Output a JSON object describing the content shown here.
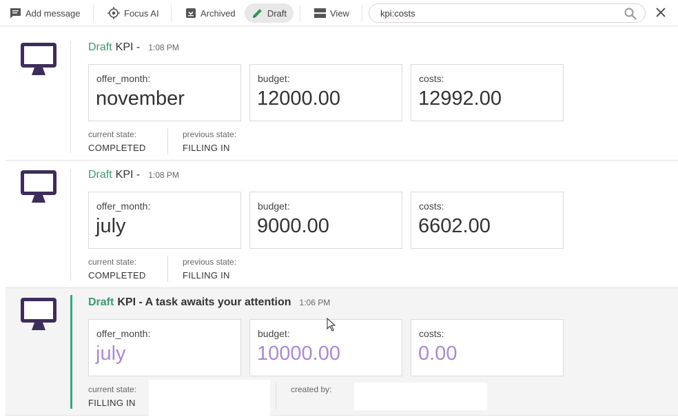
{
  "toolbar": {
    "add_message": "Add message",
    "focus_ai": "Focus AI",
    "archived": "Archived",
    "draft": "Draft",
    "view": "View"
  },
  "search": {
    "value": "kpi:costs"
  },
  "messages": [
    {
      "status": "Draft",
      "title": "KPI -",
      "time": "1:08 PM",
      "fields": [
        {
          "label": "offer_month:",
          "value": "november"
        },
        {
          "label": "budget:",
          "value": "12000.00"
        },
        {
          "label": "costs:",
          "value": "12992.00"
        }
      ],
      "current_state_label": "current state:",
      "current_state": "COMPLETED",
      "previous_state_label": "previous state:",
      "previous_state": "FILLING IN"
    },
    {
      "status": "Draft",
      "title": "KPI -",
      "time": "1:08 PM",
      "fields": [
        {
          "label": "offer_month:",
          "value": "july"
        },
        {
          "label": "budget:",
          "value": "9000.00"
        },
        {
          "label": "costs:",
          "value": "6602.00"
        }
      ],
      "current_state_label": "current state:",
      "current_state": "COMPLETED",
      "previous_state_label": "previous state:",
      "previous_state": "FILLING IN"
    },
    {
      "status": "Draft",
      "title": "KPI - A task awaits your attention",
      "time": "1:06 PM",
      "fields": [
        {
          "label": "offer_month:",
          "value": "july"
        },
        {
          "label": "budget:",
          "value": "10000.00"
        },
        {
          "label": "costs:",
          "value": "0.00"
        }
      ],
      "current_state_label": "current state:",
      "current_state": "FILLING IN",
      "created_by_label": "created by:"
    }
  ],
  "colors": {
    "draft_green": "#3a9a6c",
    "accent_bar": "#2eaa7a",
    "avatar_purple": "#3d2d5c",
    "pending_value": "#a98ad6"
  },
  "icons": [
    "message-icon",
    "focus-icon",
    "archive-icon",
    "pencil-icon",
    "view-icon",
    "search-icon",
    "close-icon",
    "monitor-icon"
  ]
}
